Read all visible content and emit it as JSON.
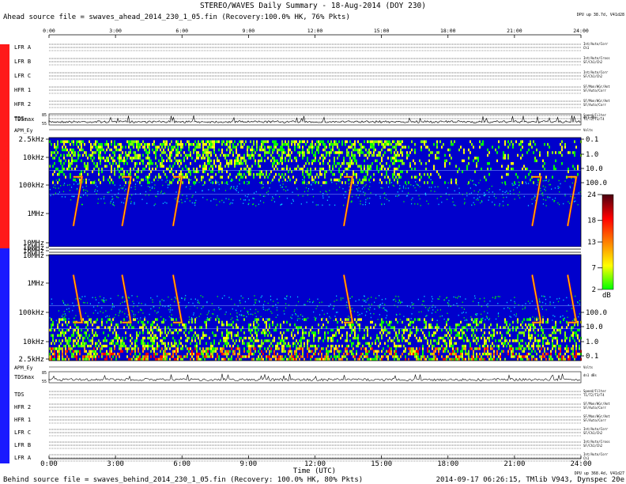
{
  "header": {
    "title": "STEREO/WAVES Daily Summary - 18-Aug-2014 (DOY 230)",
    "ahead_source": "Ahead source file = swaves_ahead_2014_230_1_05.fin (Recovery:100.0% HK, 76% Pkts)",
    "ahead_dpu": "DPU up 38.7d, V41d28",
    "behind_source": "Behind source file = swaves_behind_2014_230_1_05.fin (Recovery: 100.0% HK, 80% Pkts)",
    "behind_dpu": "DPU up 368.4d, V41d27",
    "footer_right": "2014-09-17 06:26:15, TMlib V943, Dynspec 20e"
  },
  "labels": {
    "ahead_tag": "Ahead",
    "behind_tag": "Behind",
    "time_axis": "Time (UTC)"
  },
  "time_ticks": [
    "0:00",
    "3:00",
    "6:00",
    "9:00",
    "12:00",
    "15:00",
    "18:00",
    "21:00",
    "24:00"
  ],
  "ahead_hk": [
    {
      "name": "LFR A",
      "info": "Int/Auto/Corr",
      "sub": "Ch1"
    },
    {
      "name": "LFR B",
      "info": "Int/Auto/Cross",
      "sub": "SF/Ch1/Ch2"
    },
    {
      "name": "LFR C",
      "info": "Int/Auto/Corr",
      "sub": "SF/Ch1/Ch2"
    },
    {
      "name": "HFR 1",
      "info": "SF/Mon/HGr/Ant",
      "sub": "SF/Auto/Corr"
    },
    {
      "name": "HFR 2",
      "info": "SF/Mon/HGr/Ant",
      "sub": "SF/Auto/Corr"
    },
    {
      "name": "TDS",
      "info": "Speed/Filter",
      "sub": "T1/T2/T3/T4"
    }
  ],
  "behind_hk": [
    {
      "name": "TDS",
      "info": "Speed/Filter",
      "sub": "T1/T2/T3/T4"
    },
    {
      "name": "HFR 2",
      "info": "SF/Mon/HGr/Ant",
      "sub": "SF/Auto/Corr"
    },
    {
      "name": "HFR 1",
      "info": "SF/Mon/HGr/Ant",
      "sub": "SF/Auto/Corr"
    },
    {
      "name": "LFR C",
      "info": "Int/Auto/Corr",
      "sub": "SF/Ch1/Ch2"
    },
    {
      "name": "LFR B",
      "info": "Int/Auto/Cross",
      "sub": "SF/Ch1/Ch2"
    },
    {
      "name": "LFR A",
      "info": "Int/Auto/Corr",
      "sub": "Ch1"
    }
  ],
  "tdsmax": {
    "label": "TDSmax",
    "ahead_info": "dn1 dBs",
    "behind_info": "dn1 dBs",
    "scale_top": "85",
    "scale_bot": "55"
  },
  "apm": {
    "label": "APM_Ey",
    "info": "Volts"
  },
  "freq_ticks_ahead": [
    "2.5kHz",
    "10kHz",
    "100kHz",
    "1MHz",
    "10MHz",
    "16MHz"
  ],
  "freq_ticks_behind": [
    "16MHz",
    "10MHz",
    "1MHz",
    "100kHz",
    "10kHz",
    "2.5kHz"
  ],
  "wavelength_ticks_ahead": [
    "0.1",
    "1.0",
    "10.0",
    "100.0"
  ],
  "wavelength_ticks_behind": [
    "100.0",
    "10.0",
    "1.0",
    "0.1"
  ],
  "colorbar": {
    "ticks": [
      "24",
      "18",
      "13",
      "7",
      "2"
    ],
    "unit": "dB",
    "range": [
      2,
      24
    ]
  },
  "colors": {
    "ahead": "#ff1a1a",
    "behind": "#1a1aff",
    "background": "#0000cc"
  },
  "chart_data": {
    "type": "heatmap",
    "title": "STEREO/WAVES Daily Summary - 18-Aug-2014 (DOY 230)",
    "xlabel": "Time (UTC)",
    "ylabel": "",
    "x_range_hours": [
      0,
      24
    ],
    "y_scale": "log",
    "y_range": [
      "2.5kHz",
      "16MHz"
    ],
    "z_unit": "dB",
    "z_range": [
      2,
      24
    ],
    "panels": [
      "Ahead",
      "Behind"
    ],
    "type_iii_bursts_hours": [
      1.1,
      3.3,
      5.6,
      13.3,
      21.8,
      23.4
    ]
  }
}
